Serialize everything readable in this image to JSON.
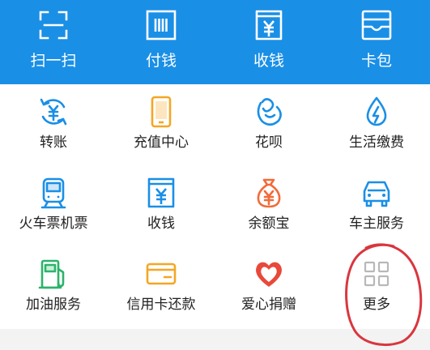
{
  "top_bar": {
    "bg_color": "#1a8fe6",
    "items": [
      {
        "label": "扫一扫",
        "icon": "scan-icon"
      },
      {
        "label": "付钱",
        "icon": "pay-code-icon"
      },
      {
        "label": "收钱",
        "icon": "receive-money-icon"
      },
      {
        "label": "卡包",
        "icon": "card-wallet-icon"
      }
    ]
  },
  "grid": {
    "items": [
      {
        "label": "转账",
        "icon": "transfer-icon",
        "color": "#1a8fe6"
      },
      {
        "label": "充值中心",
        "icon": "phone-recharge-icon",
        "color": "#f5a623"
      },
      {
        "label": "花呗",
        "icon": "huabei-icon",
        "color": "#1a8fe6"
      },
      {
        "label": "生活缴费",
        "icon": "utility-payment-icon",
        "color": "#1a8fe6"
      },
      {
        "label": "火车票机票",
        "icon": "train-ticket-icon",
        "color": "#1a8fe6"
      },
      {
        "label": "收钱",
        "icon": "receive-money-icon",
        "color": "#1a8fe6"
      },
      {
        "label": "余额宝",
        "icon": "yuebao-icon",
        "color": "#f26b3a"
      },
      {
        "label": "车主服务",
        "icon": "car-service-icon",
        "color": "#1a8fe6"
      },
      {
        "label": "加油服务",
        "icon": "fuel-icon",
        "color": "#2db36b"
      },
      {
        "label": "信用卡还款",
        "icon": "credit-card-icon",
        "color": "#f5a623"
      },
      {
        "label": "爱心捐赠",
        "icon": "donation-heart-icon",
        "color": "#e8493a"
      },
      {
        "label": "更多",
        "icon": "more-grid-icon",
        "color": "#b8b8b8"
      }
    ]
  },
  "annotation_color": "#d9363e"
}
